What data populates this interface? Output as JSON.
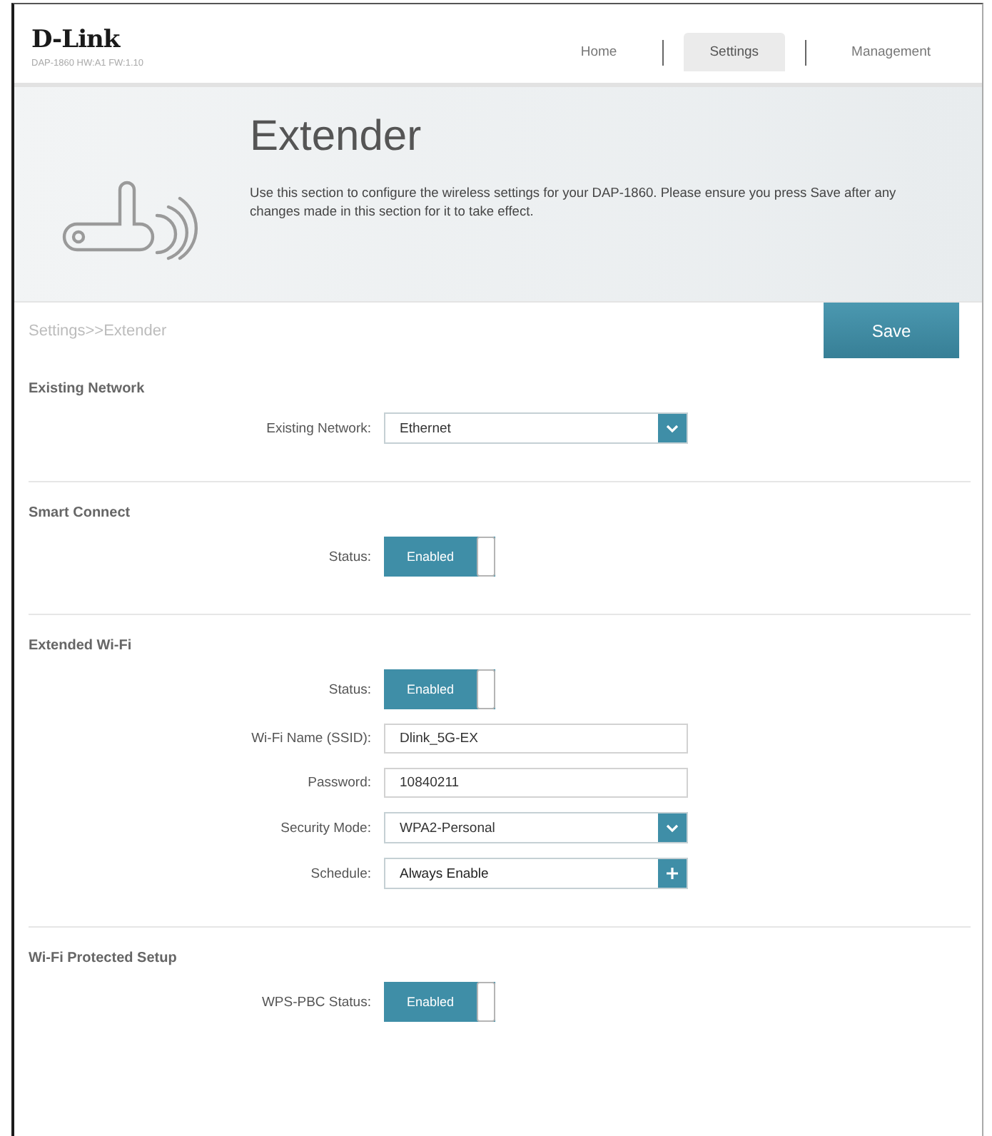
{
  "header": {
    "logo": "D-Link",
    "model_info": "DAP-1860 HW:A1 FW:1.10",
    "nav": [
      {
        "label": "Home",
        "selected": false
      },
      {
        "label": "Settings",
        "selected": true
      },
      {
        "label": "Management",
        "selected": false
      }
    ]
  },
  "banner": {
    "title": "Extender",
    "description": "Use this section to configure the wireless settings for your DAP-1860. Please ensure you press Save after any changes made in this section for it to take effect."
  },
  "breadcrumb": "Settings>>Extender",
  "save_button": "Save",
  "sections": [
    {
      "title": "Existing Network",
      "fields": [
        {
          "kind": "select",
          "label": "Existing Network:",
          "value": "Ethernet"
        }
      ]
    },
    {
      "title": "Smart Connect",
      "fields": [
        {
          "kind": "toggle",
          "label": "Status:",
          "value": "Enabled",
          "on": true
        }
      ]
    },
    {
      "title": "Extended Wi-Fi",
      "fields": [
        {
          "kind": "toggle",
          "label": "Status:",
          "value": "Enabled",
          "on": true
        },
        {
          "kind": "text",
          "label": "Wi-Fi Name (SSID):",
          "value": "Dlink_5G-EX"
        },
        {
          "kind": "text",
          "label": "Password:",
          "value": "10840211"
        },
        {
          "kind": "select",
          "label": "Security Mode:",
          "value": "WPA2-Personal"
        },
        {
          "kind": "schedule",
          "label": "Schedule:",
          "value": "Always Enable"
        }
      ]
    },
    {
      "title": "Wi-Fi Protected Setup",
      "fields": [
        {
          "kind": "toggle",
          "label": "WPS-PBC Status:",
          "value": "Enabled",
          "on": true
        }
      ]
    }
  ]
}
